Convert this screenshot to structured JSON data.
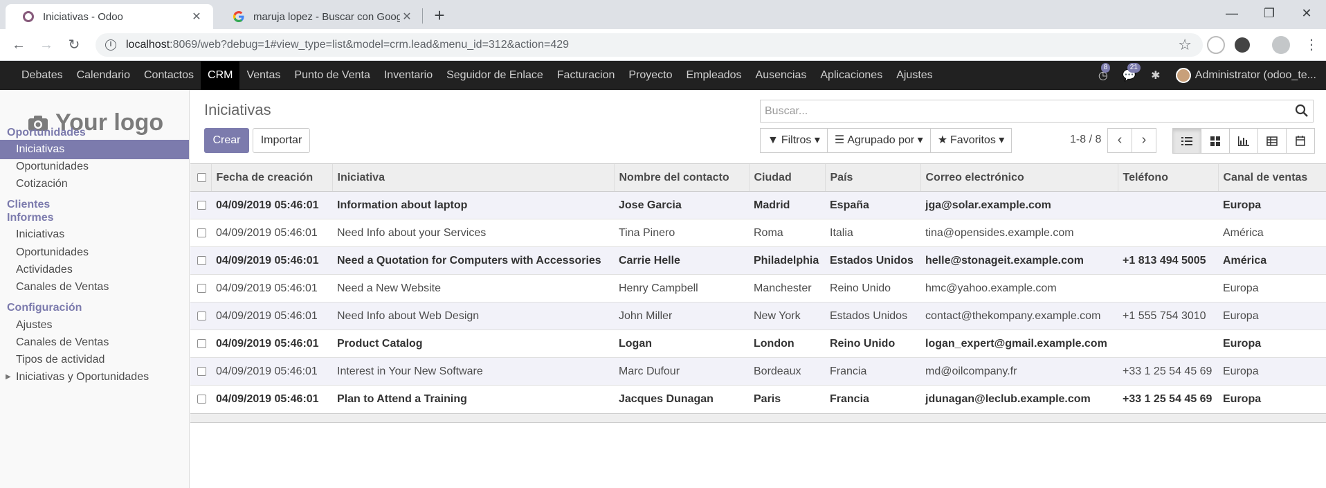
{
  "browser": {
    "tabs": [
      {
        "title": "Iniciativas - Odoo",
        "active": true,
        "favicon": "odoo-icon"
      },
      {
        "title": "maruja lopez - Buscar con Google",
        "active": false,
        "favicon": "google-icon"
      }
    ],
    "url_host": "localhost",
    "url_rest": ":8069/web?debug=1#view_type=list&model=crm.lead&menu_id=312&action=429"
  },
  "topmenu": {
    "items": [
      "Debates",
      "Calendario",
      "Contactos",
      "CRM",
      "Ventas",
      "Punto de Venta",
      "Inventario",
      "Seguidor de Enlace",
      "Facturacion",
      "Proyecto",
      "Empleados",
      "Ausencias",
      "Aplicaciones",
      "Ajustes"
    ],
    "active": "CRM",
    "activity_count": "8",
    "message_count": "21",
    "user": "Administrator (odoo_te..."
  },
  "sidebar": {
    "logo_text": "Your logo",
    "sections": [
      {
        "title": "Oportunidades",
        "items": [
          "Iniciativas",
          "Oportunidades",
          "Cotización"
        ]
      },
      {
        "title": "Clientes",
        "items": []
      },
      {
        "title": "Informes",
        "items": [
          "Iniciativas",
          "Oportunidades",
          "Actividades",
          "Canales de Ventas"
        ]
      },
      {
        "title": "Configuración",
        "items": [
          "Ajustes",
          "Canales de Ventas",
          "Tipos de actividad",
          "Iniciativas y Oportunidades"
        ]
      }
    ],
    "active_item": "Iniciativas"
  },
  "control": {
    "title": "Iniciativas",
    "create_label": "Crear",
    "import_label": "Importar",
    "search_placeholder": "Buscar...",
    "filters_label": "Filtros",
    "groupby_label": "Agrupado por",
    "favorites_label": "Favoritos",
    "pager": "1-8 / 8"
  },
  "table": {
    "columns": [
      "Fecha de creación",
      "Iniciativa",
      "Nombre del contacto",
      "Ciudad",
      "País",
      "Correo electrónico",
      "Teléfono",
      "Canal de ventas"
    ],
    "rows": [
      {
        "bold": true,
        "cells": [
          "04/09/2019 05:46:01",
          "Information about laptop",
          "Jose Garcia",
          "Madrid",
          "España",
          "jga@solar.example.com",
          "",
          "Europa"
        ]
      },
      {
        "bold": false,
        "cells": [
          "04/09/2019 05:46:01",
          "Need Info about your Services",
          "Tina Pinero",
          "Roma",
          "Italia",
          "tina@opensides.example.com",
          "",
          "América"
        ]
      },
      {
        "bold": true,
        "cells": [
          "04/09/2019 05:46:01",
          "Need a Quotation for Computers with Accessories",
          "Carrie Helle",
          "Philadelphia",
          "Estados Unidos",
          "helle@stonageit.example.com",
          "+1 813 494 5005",
          "América"
        ]
      },
      {
        "bold": false,
        "cells": [
          "04/09/2019 05:46:01",
          "Need a New Website",
          "Henry Campbell",
          "Manchester",
          "Reino Unido",
          "hmc@yahoo.example.com",
          "",
          "Europa"
        ]
      },
      {
        "bold": false,
        "cells": [
          "04/09/2019 05:46:01",
          "Need Info about Web Design",
          "John Miller",
          "New York",
          "Estados Unidos",
          "contact@thekompany.example.com",
          "+1 555 754 3010",
          "Europa"
        ]
      },
      {
        "bold": true,
        "cells": [
          "04/09/2019 05:46:01",
          "Product Catalog",
          "Logan",
          "London",
          "Reino Unido",
          "logan_expert@gmail.example.com",
          "",
          "Europa"
        ]
      },
      {
        "bold": false,
        "cells": [
          "04/09/2019 05:46:01",
          "Interest in Your New Software",
          "Marc Dufour",
          "Bordeaux",
          "Francia",
          "md@oilcompany.fr",
          "+33 1 25 54 45 69",
          "Europa"
        ]
      },
      {
        "bold": true,
        "cells": [
          "04/09/2019 05:46:01",
          "Plan to Attend a Training",
          "Jacques Dunagan",
          "Paris",
          "Francia",
          "jdunagan@leclub.example.com",
          "+33 1 25 54 45 69",
          "Europa"
        ]
      }
    ]
  },
  "colors": {
    "brand": "#7c7bad",
    "navbar": "#212121"
  }
}
